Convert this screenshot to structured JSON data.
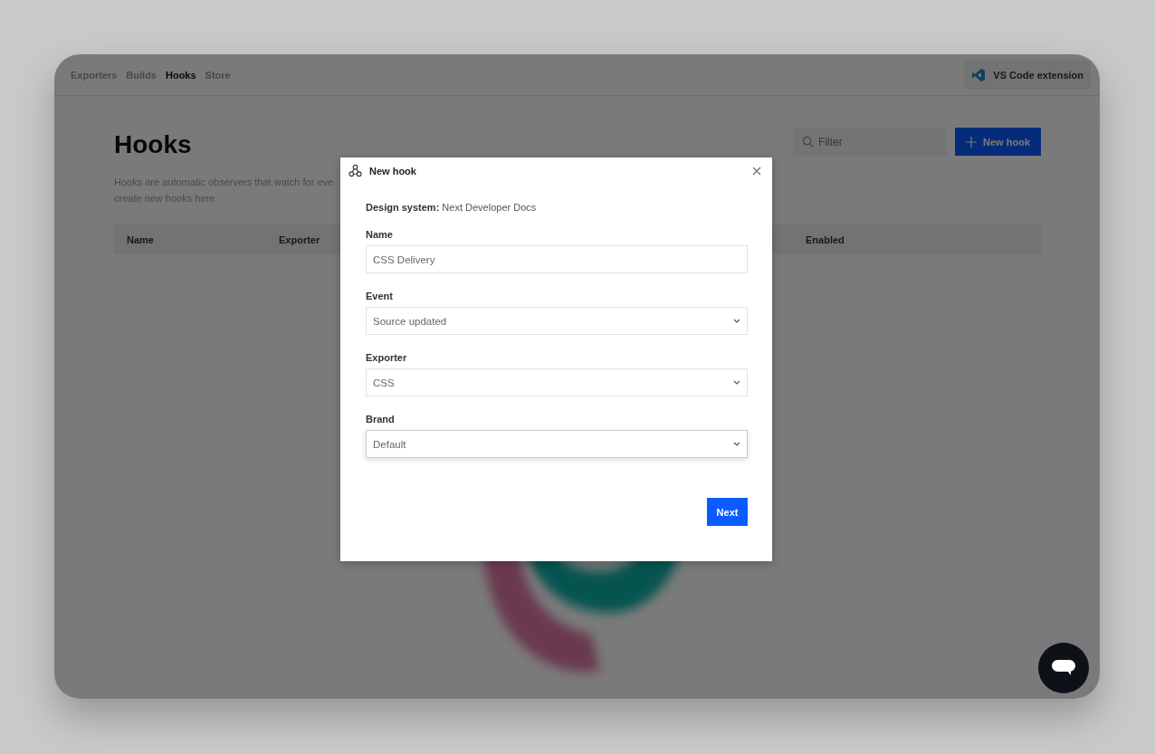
{
  "nav": {
    "tabs": [
      {
        "label": "Exporters",
        "selected": false
      },
      {
        "label": "Builds",
        "selected": false
      },
      {
        "label": "Hooks",
        "selected": true
      },
      {
        "label": "Store",
        "selected": false
      }
    ],
    "extension_button": "VS Code extension"
  },
  "page": {
    "title": "Hooks",
    "description": [
      "Hooks are automatic observers that watch for eve",
      "create new hooks here."
    ],
    "filter": {
      "placeholder": "Filter"
    },
    "new_button": "New hook",
    "table": {
      "columns": [
        "Name",
        "Exporter",
        "Enabled"
      ]
    }
  },
  "dialog": {
    "title": "New hook",
    "design_system": "**Design system:** Next Developer Docs",
    "fields": [
      {
        "label": "Name",
        "kind": "text",
        "value": "CSS Delivery",
        "focused": false
      },
      {
        "label": "Event",
        "kind": "select",
        "value": "Source updated",
        "focused": false
      },
      {
        "label": "Exporter",
        "kind": "select",
        "value": "CSS",
        "focused": false
      },
      {
        "label": "Brand",
        "kind": "select",
        "value": "Default",
        "focused": true
      }
    ],
    "submit": "Next"
  }
}
